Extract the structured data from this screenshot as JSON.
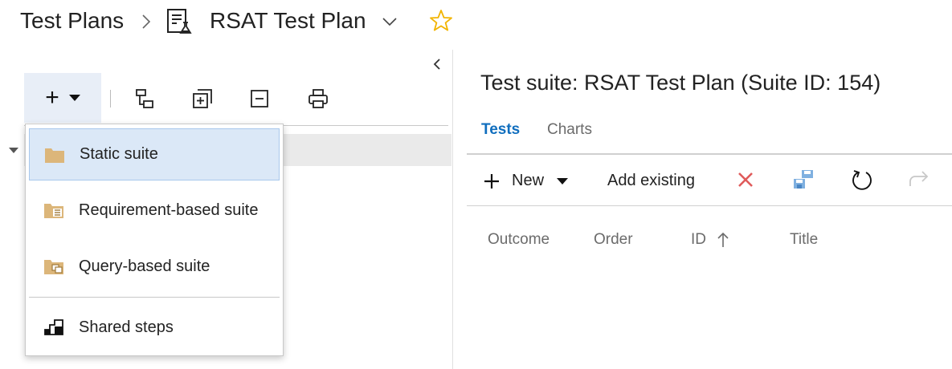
{
  "breadcrumb": {
    "root": "Test Plans",
    "current_plan": "RSAT Test Plan"
  },
  "left_toolbar": {
    "add_label": "+",
    "buttons": [
      "collapse-tree-icon",
      "expand-all-icon",
      "collapse-all-icon",
      "print-icon"
    ]
  },
  "add_menu": {
    "items": [
      {
        "label": "Static suite",
        "icon": "folder-icon",
        "selected": true
      },
      {
        "label": "Requirement-based suite",
        "icon": "requirement-folder-icon"
      },
      {
        "label": "Query-based suite",
        "icon": "query-folder-icon"
      },
      {
        "label": "Shared steps",
        "icon": "shared-steps-icon"
      }
    ]
  },
  "suite_pane": {
    "title": "Test suite: RSAT Test Plan (Suite ID: 154)",
    "tabs": [
      {
        "label": "Tests",
        "active": true
      },
      {
        "label": "Charts",
        "active": false
      }
    ],
    "commands": {
      "new_label": "New",
      "add_existing_label": "Add existing"
    },
    "columns": [
      "Outcome",
      "Order",
      "ID",
      "Title"
    ]
  },
  "colors": {
    "accent": "#106ebe",
    "delete": "#e05a5a",
    "star": "#f2b400",
    "folder": "#dcb67a"
  }
}
